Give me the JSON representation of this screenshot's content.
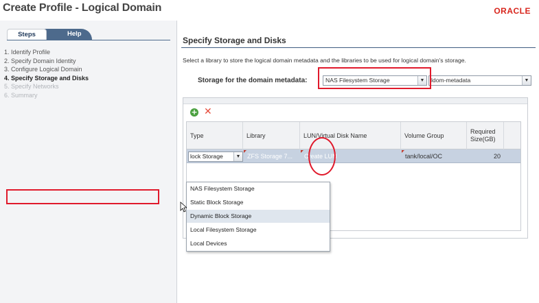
{
  "window": {
    "title": "Create Profile - Logical Domain",
    "brand": "ORACLE"
  },
  "colors": {
    "brand": "#d8261d",
    "accent": "#4d6a8c",
    "highlight": "#e0192b",
    "selected_row": "#c7d2e1"
  },
  "left_panel": {
    "tabs": [
      "Steps",
      "Help"
    ],
    "steps": [
      "1. Identify Profile",
      "2. Specify Domain Identity",
      "3. Configure Logical Domain",
      "4. Specify Storage and Disks",
      "5. Specify Networks",
      "6. Summary"
    ]
  },
  "main": {
    "section_title": "Specify Storage and Disks",
    "instruction": "Select a library to store the logical domain metadata and the libraries to be used for logical domain's storage.",
    "metadata_label": "Storage for the domain metadata:",
    "metadata_type": "NAS Filesystem Storage",
    "metadata_library": "ldom-metadata",
    "toolbar": {
      "add_icon": "add-icon",
      "delete_icon": "delete-icon"
    },
    "table": {
      "columns": [
        "Type",
        "Library",
        "LUN/Virtual Disk Name",
        "Volume Group",
        "Required Size(GB)"
      ],
      "rows": [
        {
          "type": "lock Storage",
          "library": "ZFS Storage 7...",
          "lun": "Create LUN",
          "volume_group": "tank/local/OC",
          "size": "20"
        }
      ]
    },
    "type_dropdown": {
      "options": [
        "NAS Filesystem Storage",
        "Static Block Storage",
        "Dynamic Block Storage",
        "Local Filesystem Storage",
        "Local Devices"
      ],
      "hovered": "Dynamic Block Storage"
    }
  }
}
